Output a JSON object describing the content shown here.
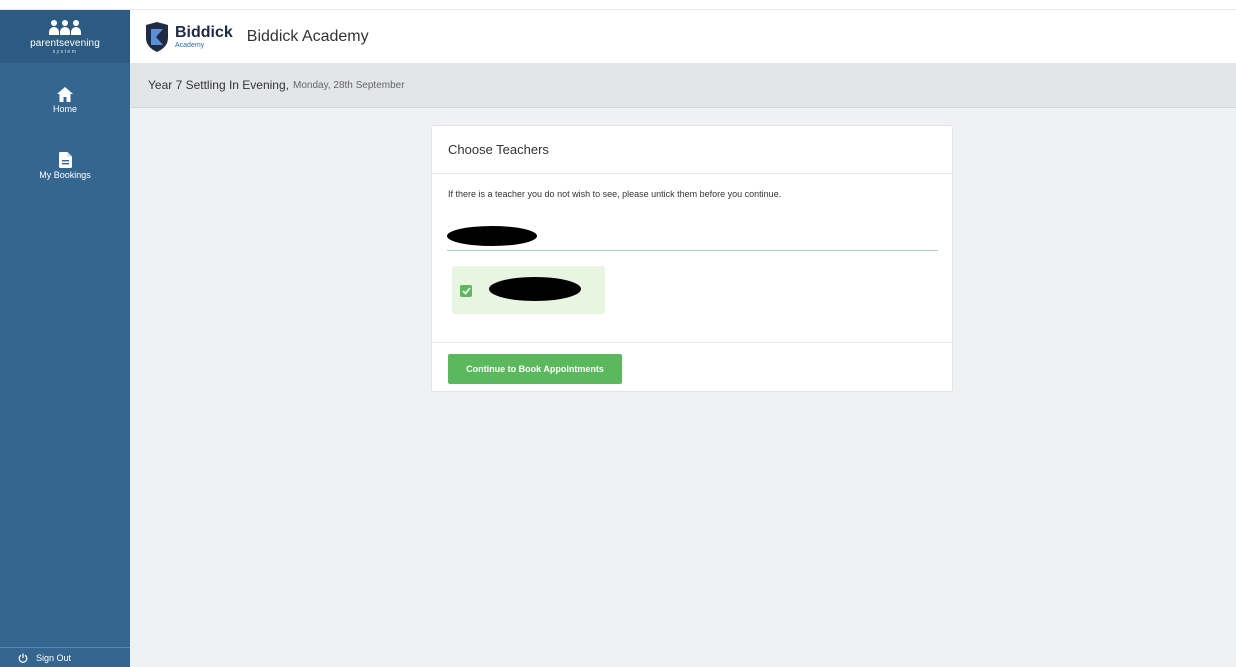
{
  "sidebar": {
    "brand": {
      "name": "parentsevening",
      "sub": "system"
    },
    "items": [
      {
        "label": "Home",
        "icon": "home-icon"
      },
      {
        "label": "My Bookings",
        "icon": "document-icon"
      }
    ],
    "signout_label": "Sign Out"
  },
  "header": {
    "logo_title": "Biddick",
    "logo_sub": "Academy",
    "school_name": "Biddick Academy"
  },
  "event": {
    "title": "Year 7 Settling In Evening,",
    "date": "Monday, 28th September"
  },
  "card": {
    "title": "Choose Teachers",
    "instructions": "If there is a teacher you do not wish to see, please untick them before you continue.",
    "teacher_checked": true,
    "continue_label": "Continue to Book Appointments"
  },
  "colors": {
    "sidebar": "#356690",
    "accent_green": "#5cb85c",
    "tile_green": "#e7f5e1",
    "background": "#f0f1f3"
  }
}
